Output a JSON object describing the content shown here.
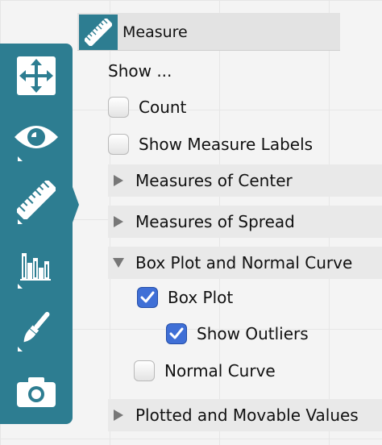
{
  "toolbar": {
    "tools": [
      {
        "name": "move-icon"
      },
      {
        "name": "eye-icon"
      },
      {
        "name": "ruler-icon"
      },
      {
        "name": "bar-chart-icon"
      },
      {
        "name": "paintbrush-icon"
      },
      {
        "name": "camera-icon"
      }
    ],
    "active_tool": "ruler-icon",
    "accent_color": "#2d7d91"
  },
  "panel": {
    "title": "Measure",
    "show_label": "Show ...",
    "count": {
      "label": "Count",
      "checked": false
    },
    "show_measure_labels": {
      "label": "Show Measure Labels",
      "checked": false
    },
    "sections": {
      "center": {
        "label": "Measures of Center",
        "expanded": false
      },
      "spread": {
        "label": "Measures of Spread",
        "expanded": false
      },
      "boxplot": {
        "label": "Box Plot and Normal Curve",
        "expanded": true
      },
      "plotted": {
        "label": "Plotted and Movable Values",
        "expanded": false
      }
    },
    "box_plot": {
      "label": "Box Plot",
      "checked": true
    },
    "show_outliers": {
      "label": "Show Outliers",
      "checked": true
    },
    "normal_curve": {
      "label": "Normal Curve",
      "checked": false
    }
  }
}
